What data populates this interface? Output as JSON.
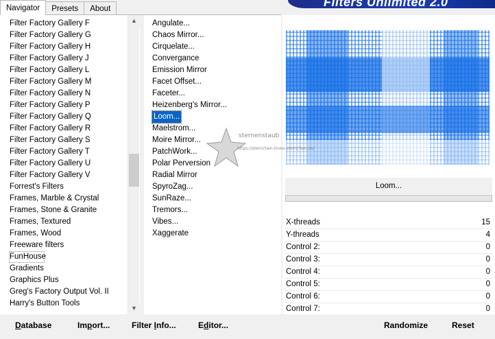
{
  "tabs": [
    {
      "label": "Navigator",
      "active": true
    },
    {
      "label": "Presets",
      "active": false
    },
    {
      "label": "About",
      "active": false
    }
  ],
  "banner": {
    "title": "Filters Unlimited 2.0"
  },
  "categories": [
    "Filter Factory Gallery F",
    "Filter Factory Gallery G",
    "Filter Factory Gallery H",
    "Filter Factory Gallery J",
    "Filter Factory Gallery L",
    "Filter Factory Gallery M",
    "Filter Factory Gallery N",
    "Filter Factory Gallery P",
    "Filter Factory Gallery Q",
    "Filter Factory Gallery R",
    "Filter Factory Gallery S",
    "Filter Factory Gallery T",
    "Filter Factory Gallery U",
    "Filter Factory Gallery V",
    "Forrest's Filters",
    "Frames, Marble & Crystal",
    "Frames, Stone & Granite",
    "Frames, Textured",
    "Frames, Wood",
    "Freeware filters",
    "FunHouse",
    "Gradients",
    "Graphics Plus",
    "Greg's Factory Output Vol. II",
    "Harry's Button Tools"
  ],
  "focused_category": "FunHouse",
  "filters": [
    "Angulate...",
    "Chaos Mirror...",
    "Cirquelate...",
    "Convergance",
    "Emission Mirror",
    "Facet Offset...",
    "Faceter...",
    "Heizenberg's Mirror...",
    "Loom...",
    "Maelstrom...",
    "Moire Mirror...",
    "PatchWork...",
    "Polar Perversion",
    "Radial Mirror",
    "SpyroZag...",
    "SunRaze...",
    "Tremors...",
    "Vibes...",
    "Xaggerate"
  ],
  "selected_filter": "Loom...",
  "preview": {
    "filter_name": "Loom...",
    "accent_color": "#146ee6"
  },
  "controls": [
    {
      "label": "X-threads",
      "value": "15"
    },
    {
      "label": "Y-threads",
      "value": "4"
    },
    {
      "label": "Control 2:",
      "value": "0"
    },
    {
      "label": "Control 3:",
      "value": "0"
    },
    {
      "label": "Control 4:",
      "value": "0"
    },
    {
      "label": "Control 5:",
      "value": "0"
    },
    {
      "label": "Control 6:",
      "value": "0"
    },
    {
      "label": "Control 7:",
      "value": "0"
    }
  ],
  "bottom_buttons": {
    "database": {
      "first": "D",
      "rest": "atabase"
    },
    "import": {
      "first": "Im",
      "u": "p",
      "rest": "ort..."
    },
    "filter_info": {
      "first": "Filter ",
      "u": "I",
      "rest": "nfo..."
    },
    "editor": {
      "first": "E",
      "u": "d",
      "rest": "itor..."
    },
    "randomize": "Randomize",
    "reset": "Reset"
  },
  "watermark": {
    "line1": "sternenstaub",
    "line2": "https://sternchen-loves-sternchen.de/"
  }
}
